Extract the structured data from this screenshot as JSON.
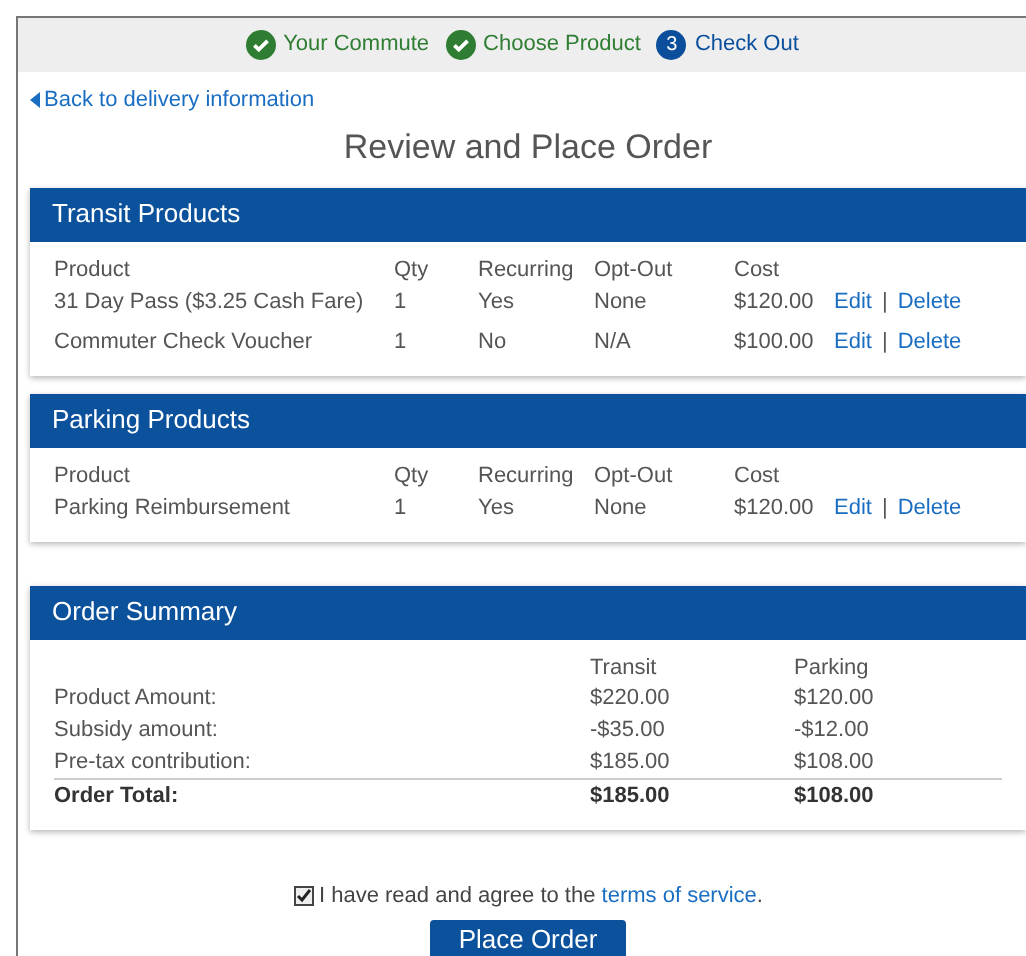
{
  "steps": [
    {
      "label": "Your Commute",
      "kind": "done"
    },
    {
      "label": "Choose Product",
      "kind": "done"
    },
    {
      "number": "3",
      "label": "Check Out",
      "kind": "current"
    }
  ],
  "back_link": "Back to delivery information",
  "title": "Review and Place Order",
  "product_panels": [
    {
      "title": "Transit Products",
      "columns": [
        "Product",
        "Qty",
        "Recurring",
        "Opt-Out",
        "Cost"
      ],
      "rows": [
        {
          "cells": [
            "31 Day Pass ($3.25 Cash Fare)",
            "1",
            "Yes",
            "None",
            "$120.00"
          ],
          "edit": "Edit",
          "separator": "|",
          "delete": "Delete"
        },
        {
          "cells": [
            "Commuter Check Voucher",
            "1",
            "No",
            "N/A",
            "$100.00"
          ],
          "edit": "Edit",
          "separator": "|",
          "delete": "Delete"
        }
      ]
    },
    {
      "title": "Parking Products",
      "columns": [
        "Product",
        "Qty",
        "Recurring",
        "Opt-Out",
        "Cost"
      ],
      "rows": [
        {
          "cells": [
            "Parking Reimbursement",
            "1",
            "Yes",
            "None",
            "$120.00"
          ],
          "edit": "Edit",
          "separator": "|",
          "delete": "Delete"
        }
      ]
    }
  ],
  "order_summary": {
    "title": "Order Summary",
    "columns": [
      "Transit",
      "Parking"
    ],
    "rows": [
      {
        "label": "Product Amount:",
        "values": [
          "$220.00",
          "$120.00"
        ],
        "total": false
      },
      {
        "label": "Subsidy amount:",
        "values": [
          "-$35.00",
          "-$12.00"
        ],
        "total": false
      },
      {
        "label": "Pre-tax contribution:",
        "values": [
          "$185.00",
          "$108.00"
        ],
        "total": false
      },
      {
        "label": "Order Total:",
        "values": [
          "$185.00",
          "$108.00"
        ],
        "total": true
      }
    ]
  },
  "agreement": {
    "checked": true,
    "text": "I have read and agree to the",
    "link": "terms of service",
    "after": "."
  },
  "place_order_button": "Place Order"
}
